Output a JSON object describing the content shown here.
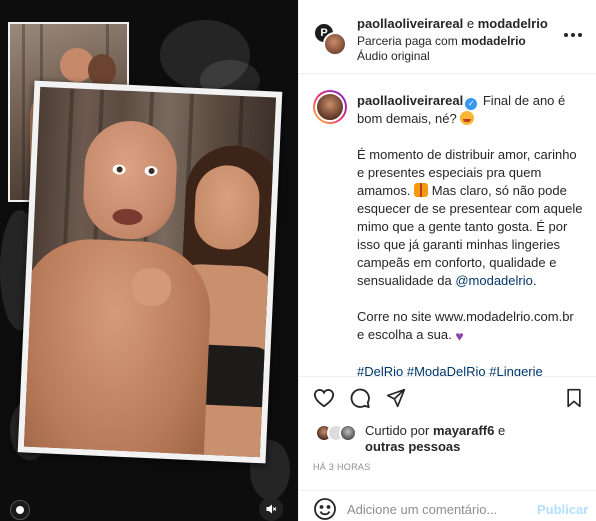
{
  "header": {
    "username": "paollaoliveirareal",
    "conjunction": "e",
    "partner": "modadelrio",
    "partnership_prefix": "Parceria paga com",
    "partnership_brand": "modadelrio",
    "audio": "Áudio original"
  },
  "caption": {
    "username": "paollaoliveirareal",
    "line1": "Final de ano é bom demais, né?",
    "para2a": "É momento de distribuir amor, carinho e presentes especiais pra quem amamos.",
    "para2b": "Mas claro, só não pode esquecer de se presentear com aquele mimo que a gente tanto gosta. É por isso que já garanti minhas lingeries campeãs em conforto, qualidade e sensualidade da",
    "mention": "@modadelrio",
    "para2end": ".",
    "para3": "Corre no site www.modadelrio.com.br e escolha a sua.",
    "hashtags": [
      "#DelRio",
      "#ModaDelRio",
      "#Lingerie"
    ]
  },
  "likes": {
    "prefix": "Curtido por",
    "user": "mayaraff6",
    "connector": "e",
    "others": "outras pessoas"
  },
  "timestamp": "HÁ 3 HORAS",
  "comment": {
    "placeholder": "Adicione um comentário...",
    "publish": "Publicar"
  },
  "icons": {
    "like": "heart-icon",
    "comment": "comment-icon",
    "share": "share-icon",
    "save": "bookmark-icon",
    "more": "more-dots-icon",
    "emoji": "emoji-icon",
    "mute": "mute-icon",
    "verified": "verified-badge-icon"
  },
  "colors": {
    "link": "#00376b",
    "verified": "#3897f0",
    "publish_disabled": "#b2dffc",
    "muted_text": "#8e8e8e"
  }
}
